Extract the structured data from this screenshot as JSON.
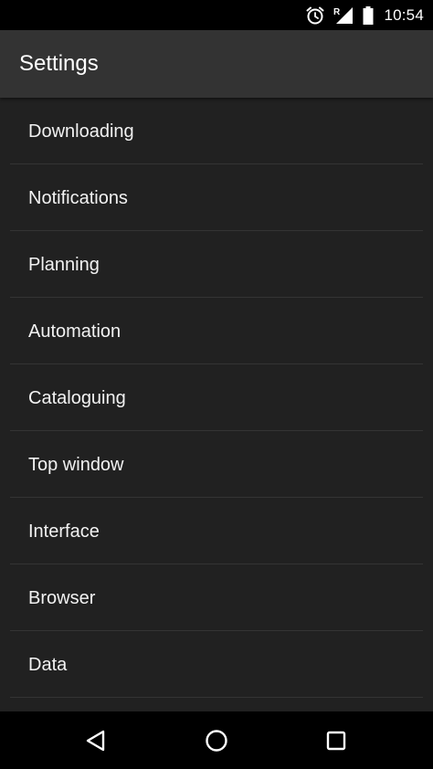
{
  "status_bar": {
    "time": "10:54",
    "icons": [
      "alarm-icon",
      "signal-roaming-icon",
      "battery-icon"
    ],
    "roaming_indicator": "R"
  },
  "app_bar": {
    "title": "Settings"
  },
  "settings": {
    "items": [
      {
        "label": "Downloading"
      },
      {
        "label": "Notifications"
      },
      {
        "label": "Planning"
      },
      {
        "label": "Automation"
      },
      {
        "label": "Cataloguing"
      },
      {
        "label": "Top window"
      },
      {
        "label": "Interface"
      },
      {
        "label": "Browser"
      },
      {
        "label": "Data"
      }
    ]
  },
  "nav_bar": {
    "buttons": [
      "back-icon",
      "home-icon",
      "recents-icon"
    ]
  },
  "colors": {
    "background": "#212121",
    "app_bar": "#333333",
    "divider": "#343434",
    "status_bar": "#000000",
    "text": "#ffffff"
  }
}
